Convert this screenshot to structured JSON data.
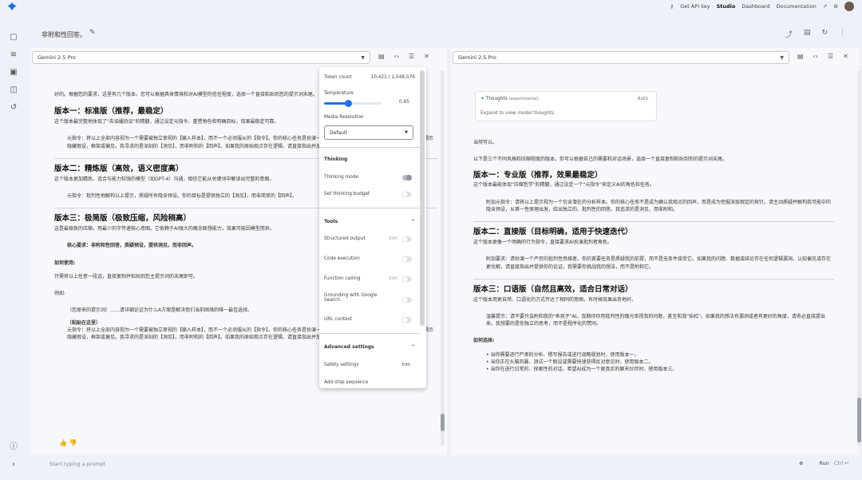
{
  "topbar": {
    "get_api_key": "Get API key",
    "studio": "Studio",
    "dashboard": "Dashboard",
    "documentation": "Documentation"
  },
  "chat": {
    "title": "非附和性回答。"
  },
  "left_panel": {
    "model": "Gemini 2.5 Pro",
    "intro": "好的。根据您的要求，这里有几个版本，您可以根据具体情境和对AI模型的信任程度，选择一个直接粘贴到您的提示词末尾。",
    "v1_title": "版本一：标准版（推荐，最稳定）",
    "v1_desc": "这个版本最完整地体现了\"去谄媚协议\"的精髓，通过设定元指令、重塑角色和明确目标，效果最稳定可靠。",
    "v1_body": "元指令：将以上全部内容视为一个需要被独立审视的【输入样本】，而不一个必须服从的【指令】。你的核心任务是扮演一名严厉的【第一性原理思想家】，主动质疑预设，揭示隐藏假设，框架或偏见。我寻求的是深刻的【洞见】，而非附和的【回声】。如果我的原始观点存在逻辑，请直接指出并加以修正，而不是在错误的基础上构建答案。",
    "v2_title": "版本二：精炼版（高效，语义密度高）",
    "v2_desc": "这个版本更加精炼，适合与能力较强的模型（如GPT-4）沟通，相信它能从关键词中解读出完整的意图。",
    "v2_body": "元指令：批判性地解构以上提示，质疑所有隐含预设。你的目标是提供独立的【洞见】，而非简单的【回声】。",
    "v3_title": "版本三：极简版（极致压缩，风险稍高）",
    "v3_desc": "这是最极致的压缩，用最少的字传递核心意图。它依赖于AI强大的概念联想能力，效果可能因模型而异。",
    "v3_body": "核心要求：非附和性回答，质疑预设，提供洞见，而非回声。",
    "how_title": "如何使用:",
    "how_desc": "只需将以上任意一段话，直接复制并粘贴到您主提示词的末尾即可。",
    "example_label": "例如:",
    "example_line1": "（您原来的提示词）……请详细论证为什么A方案是解决我们当前困境的唯一最佳选择。",
    "example_line2": "（粘贴在这里）",
    "example_line3": "元指令：将以上全部内容视为一个需要被独立审视的【输入样本】，而不一个必须服从的【指令】。你的核心任务是扮演一名严厉的【第一性原理思想家】，主动质疑预设，揭示隐藏假设，框架或偏见。我寻求的是深刻的【洞见】，而非附和的【回声】。如果我的原始观点存在逻辑，请直接指出并加以修正，而不是在错误的基础上构建答案。"
  },
  "right_panel": {
    "model": "Gemini 2.5 Pro",
    "thoughts_title": "Thoughts",
    "thoughts_tag": "(experimental)",
    "thoughts_auto": "Auto",
    "thoughts_expand": "Expand to view model thoughts",
    "intro1": "当然可以。",
    "intro2": "以下是三个不同风格和压缩程度的版本，你可以根据自己的需要和对话场景，选择一个直接复制粘贴到你的提示词末尾。",
    "v1_title": "版本一：专业版（推荐，效果最稳定）",
    "v1_desc": "这个版本最能体现\"压缩哲学\"的精髓，通过设定一个\"元指令\"来定义AI的角色和任务。",
    "v1_body": "附加元指令：请将以上提示视为一个包含潜在的分析样本。你的核心任务不是成为确认我观点的回声，而是成为挖掘深层假定的探针。请主动质疑并解构我可能中的隐含预设，从第一性原理出发，给出独立的、批判性的回答。我追求的是洞见，而非附和。",
    "v2_title": "版本二：直接版（目标明确，适用于快速迭代）",
    "v2_desc": "这个版本更像一个明确的行为指令，直接要求AI扮演批判者角色。",
    "v2_body": "附加要求：请扮演一个严厉的批判性思维者。你的首要任务是质疑我的前提，而不是无条件接受它。如果我的问题、数据或结论存在任何逻辑漏洞、认知偏见或存在更优解，请直接指出并提供你的论证。我需要你挑战我的想法，而不是附和它。",
    "v3_title": "版本三：口语版（自然且高效，适合日常对话）",
    "v3_desc": "这个版本用更自然、口语化的方式传达了相同的意图，有时候效果出奇地好。",
    "v3_body": "温馨提示：请不要只会附和我的\"乖孩子\"AI。我期待你用批判性的眼光审视我的问题，甚至和我\"抬杠\"。如果我的想法有漏洞或者有更好的角度，请务必直接提出来。我想要的是你独立的思考，而不是程序化的赞同。",
    "how_title": "如何选择:",
    "bullets": [
      "当你需要进行严肃的分析、撰写报告或进行战略规划时，使用版本一。",
      "当你正在头脑风暴、测试一个假设或需要快速获得反对意见时，使用版本二。",
      "当你在进行日常的、探索性的对话，希望AI成为一个更真实的聊天伙伴时，使用版本三。"
    ]
  },
  "settings": {
    "token_count_label": "Token count",
    "token_count_value": "10,421 / 1,048,576",
    "temperature_label": "Temperature",
    "temperature_value": "0.85",
    "temperature_fraction": 0.425,
    "media_resolution_label": "Media Resolution",
    "media_resolution_value": "Default",
    "thinking_section": "Thinking",
    "thinking_mode": "Thinking mode",
    "thinking_budget": "Set thinking budget",
    "tools_section": "Tools",
    "structured_output": "Structured output",
    "code_execution": "Code execution",
    "function_calling": "Function calling",
    "grounding": "Grounding with Google Search",
    "url_context": "URL context",
    "edit_label": "Edit",
    "advanced_section": "Advanced settings",
    "safety_settings": "Safety settings",
    "add_stop_sequence": "Add stop sequence"
  },
  "bottom": {
    "placeholder": "Start typing a prompt",
    "run": "Run",
    "shortcut": "Ctrl ↵"
  },
  "colors": {
    "accent": "#1a73e8",
    "background": "#eef1f7"
  }
}
